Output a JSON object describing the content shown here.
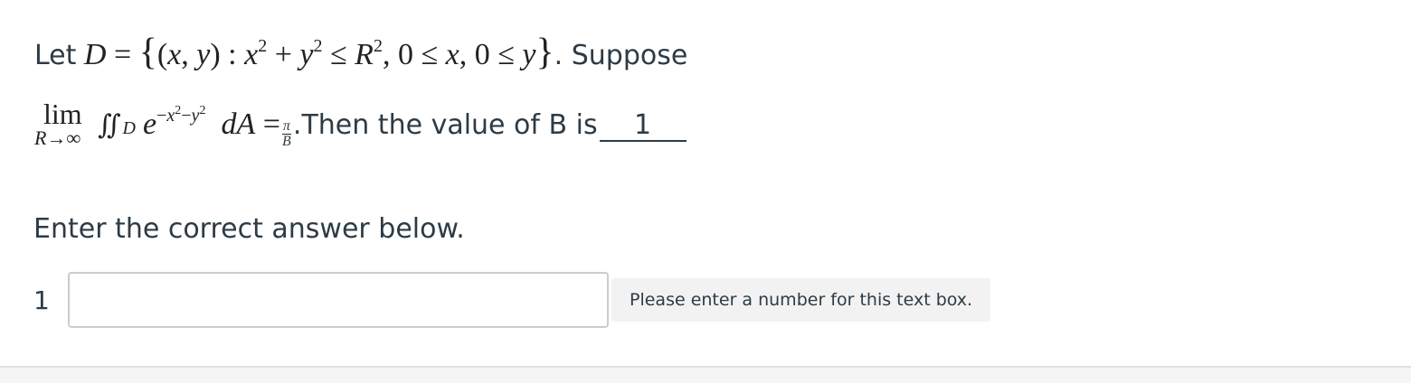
{
  "question": {
    "line1_prefix": "Let",
    "line1_suffix": ". Suppose",
    "lim_word": "lim",
    "lim_sub": "R→∞",
    "integral": "∬",
    "integral_sub": "D",
    "frac_num": "π",
    "frac_den": "B",
    "line2_text": ".Then the value of B is",
    "blank_value": "1"
  },
  "prompt": "Enter the correct answer below.",
  "answer": {
    "index": "1",
    "value": "",
    "placeholder": "",
    "tooltip": "Please enter a number for this text box."
  }
}
